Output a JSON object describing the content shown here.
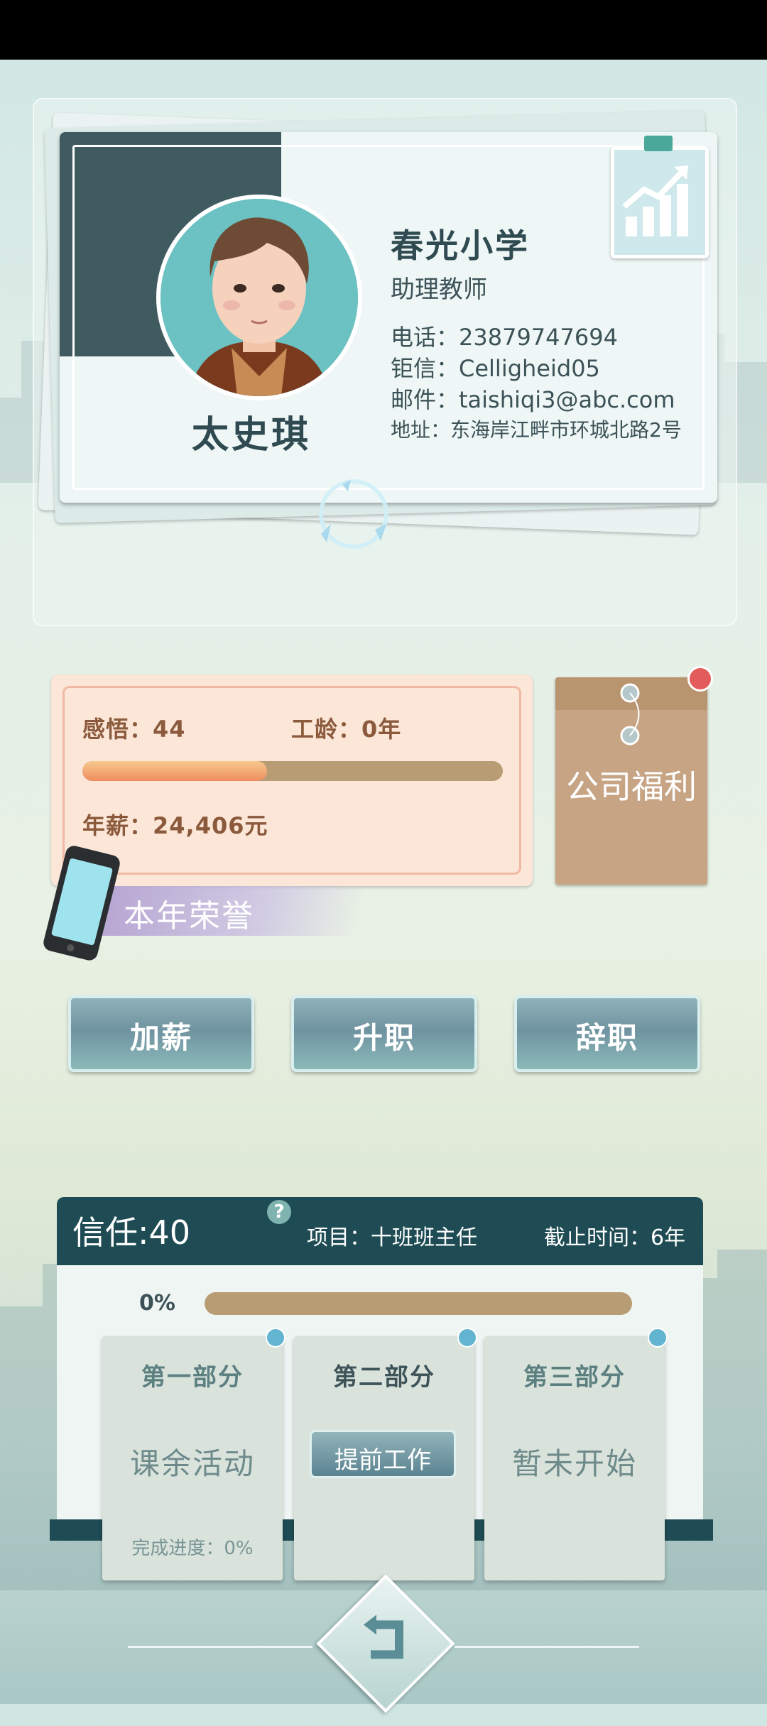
{
  "profile": {
    "name": "太史琪",
    "school": "春光小学",
    "position": "助理教师",
    "phone": "电话：23879747694",
    "wechat": "钜信：Celligheid05",
    "email": "邮件：taishiqi3@abc.com",
    "address": "地址：东海岸江畔市环城北路2号"
  },
  "stats": {
    "insight": "感悟：44",
    "seniority": "工龄：0年",
    "salary": "年薪：24,406元",
    "progress_fraction": 0.44
  },
  "honor_label": "本年荣誉",
  "welfare_label": "公司福利",
  "actions": {
    "raise": "加薪",
    "promote": "升职",
    "resign": "辞职"
  },
  "project": {
    "trust": "信任:40",
    "help": "?",
    "name": "项目：十班班主任",
    "deadline": "截止时间：6年",
    "percent": "0%",
    "progress_fraction": 0,
    "parts": [
      {
        "title": "第一部分",
        "status": "课余活动",
        "progress": "完成进度：0%"
      },
      {
        "title": "第二部分",
        "button": "提前工作"
      },
      {
        "title": "第三部分",
        "status": "暂未开始"
      }
    ]
  },
  "colors": {
    "accent": "#1f4c54",
    "progress": "#ee8d5e",
    "track": "#b89c73"
  }
}
